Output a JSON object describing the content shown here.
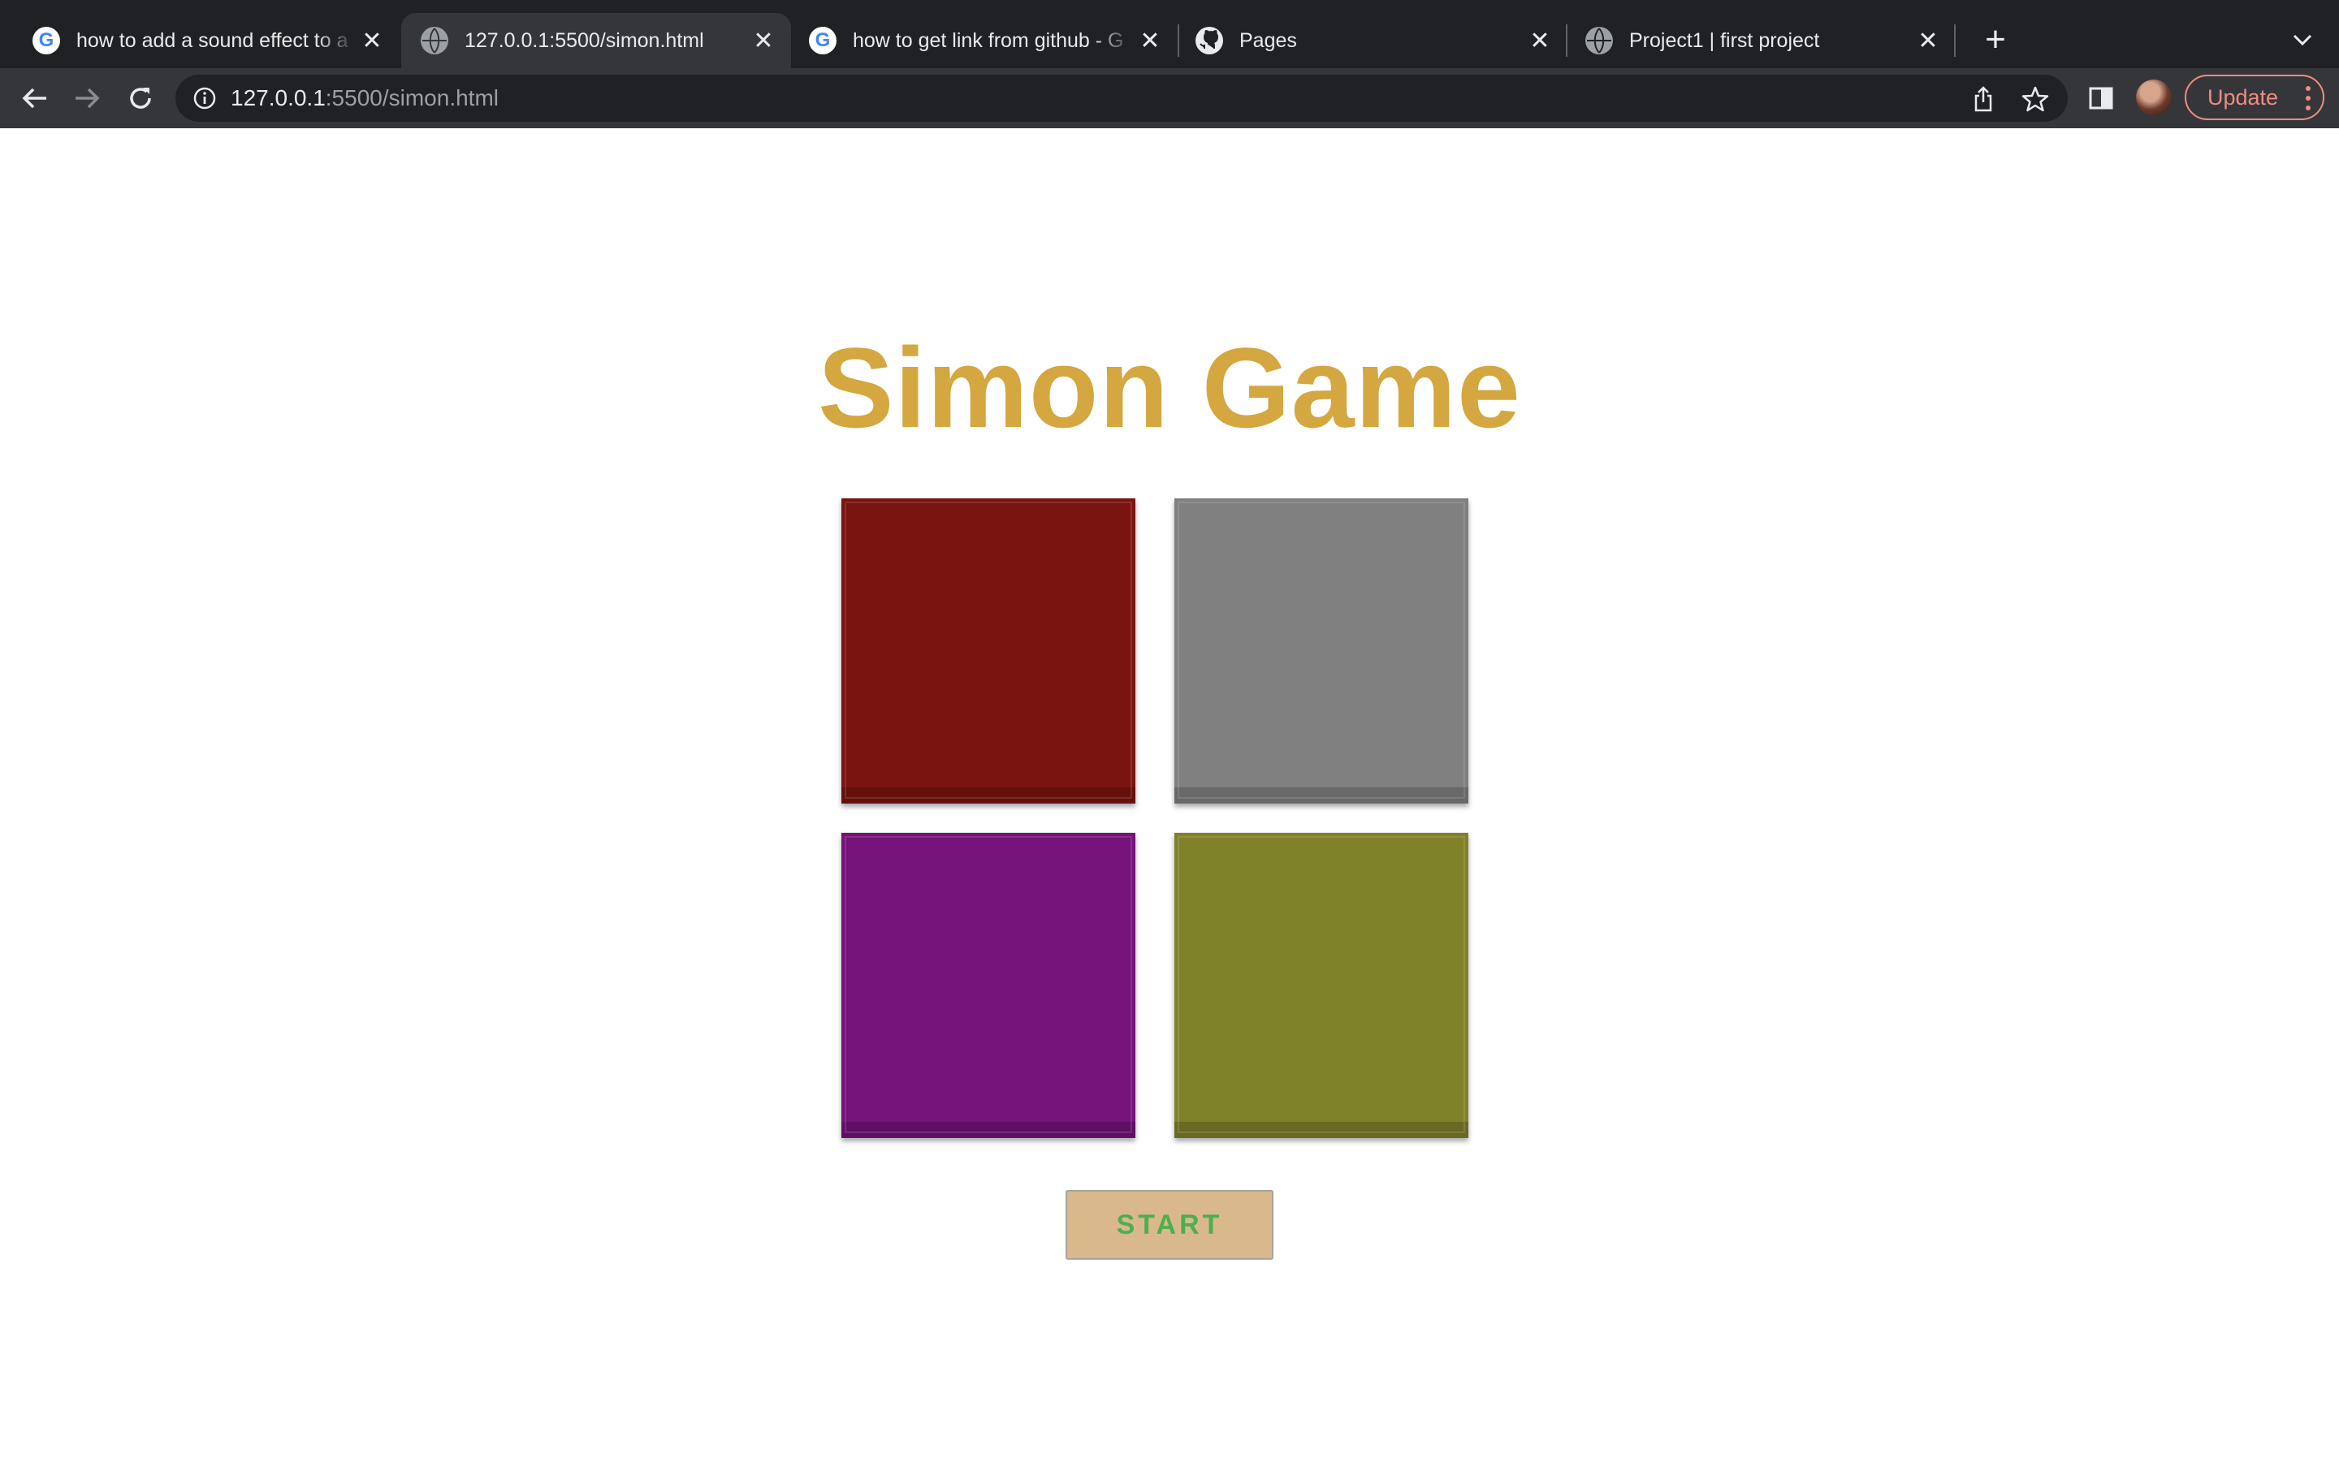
{
  "browser": {
    "tabs": [
      {
        "title": "how to add a sound effect to a",
        "favicon": "google-icon",
        "active": false
      },
      {
        "title": "127.0.0.1:5500/simon.html",
        "favicon": "globe-icon",
        "active": true
      },
      {
        "title": "how to get link from github - G",
        "favicon": "google-icon",
        "active": false
      },
      {
        "title": "Pages",
        "favicon": "github-icon",
        "active": false
      },
      {
        "title": "Project1 | first project",
        "favicon": "globe-icon",
        "active": false
      }
    ],
    "address": {
      "host": "127.0.0.1",
      "path": ":5500/simon.html"
    },
    "update_label": "Update"
  },
  "page": {
    "title": "Simon Game",
    "pads": [
      {
        "name": "red",
        "color": "#7a1410"
      },
      {
        "name": "gray",
        "color": "#808080"
      },
      {
        "name": "purple",
        "color": "#76137a"
      },
      {
        "name": "olive",
        "color": "#80822a"
      }
    ],
    "start_label": "START"
  },
  "colors": {
    "title": "#d4a740",
    "start_bg": "#d9b98b",
    "start_text": "#4caf50"
  }
}
